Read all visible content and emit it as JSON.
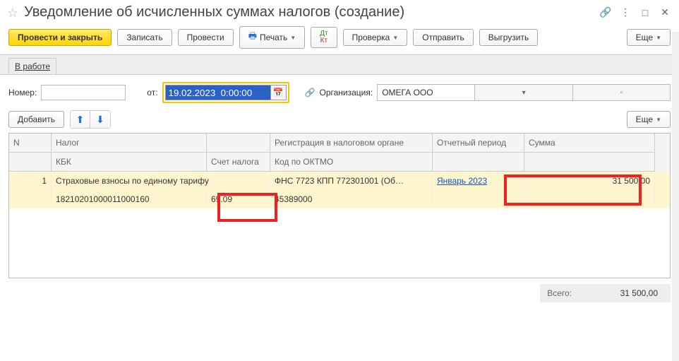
{
  "title": "Уведомление об исчисленных суммах налогов (создание)",
  "toolbar": {
    "post_close": "Провести и закрыть",
    "save": "Записать",
    "post": "Провести",
    "print": "Печать",
    "check": "Проверка",
    "send": "Отправить",
    "export": "Выгрузить",
    "more": "Еще"
  },
  "tab": "В работе",
  "labels": {
    "number": "Номер:",
    "from": "от:",
    "org": "Организация:"
  },
  "fields": {
    "number": "",
    "date": "19.02.2023  0:00:00",
    "org": "ОМЕГА ООО"
  },
  "subtoolbar": {
    "add": "Добавить",
    "more": "Еще"
  },
  "columns": {
    "n": "N",
    "tax": "Налог",
    "kbk": "КБК",
    "acct": "Счет налога",
    "reg": "Регистрация в налоговом органе",
    "oktmo": "Код по ОКТМО",
    "period": "Отчетный период",
    "sum": "Сумма"
  },
  "rows": [
    {
      "n": "1",
      "tax": "Страховые взносы по единому тарифу",
      "kbk": "18210201000011000160",
      "acct": "69.09",
      "reg": "ФНС 7723 КПП 772301001 (Об…",
      "oktmo": "45389000",
      "period": "Январь 2023",
      "sum": "31 500,00"
    }
  ],
  "footer": {
    "total_label": "Всего:",
    "total_value": "31 500,00"
  }
}
